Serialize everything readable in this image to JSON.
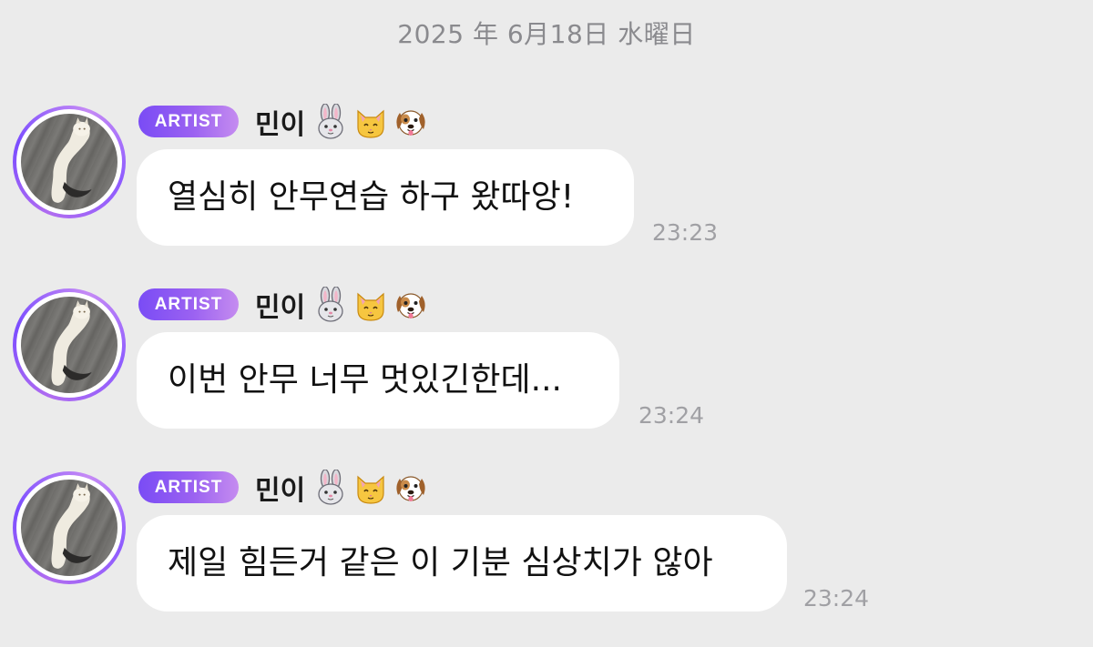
{
  "date_separator": "2025 年 6月18日 水曜日",
  "sender": {
    "badge": "ARTIST",
    "nickname": "민이",
    "emoji_icons": [
      "rabbit-face-icon",
      "cat-face-icon",
      "dog-face-icon"
    ]
  },
  "messages": [
    {
      "text": "열심히 안무연습 하구 왔따앙!",
      "time": "23:23"
    },
    {
      "text": "이번 안무 너무 멋있긴한데...",
      "time": "23:24"
    },
    {
      "text": "제일 힘든거 같은 이 기분 심상치가 않아",
      "time": "23:24"
    }
  ],
  "colors": {
    "background": "#ebebeb",
    "bubble": "#ffffff",
    "badge_start": "#7a4cf5",
    "badge_end": "#c58cf0",
    "timestamp": "#a0a0a4",
    "date_text": "#8a8a8e"
  }
}
